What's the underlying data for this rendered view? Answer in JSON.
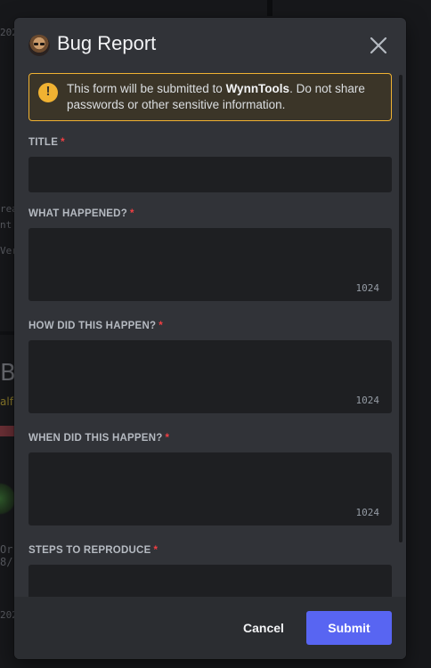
{
  "background": {
    "fragments": [
      "202",
      "rea",
      "nt",
      "Ver",
      "B",
      "alf",
      "Or",
      "8/",
      "202"
    ]
  },
  "modal": {
    "title": "Bug Report",
    "close_icon": "close-icon",
    "notice": {
      "icon": "warning-icon",
      "text_before": "This form will be submitted to ",
      "text_bold": "WynnTools",
      "text_after": ". Do not share passwords or other sensitive information.",
      "accent": "#f0b232"
    },
    "fields": [
      {
        "label": "TITLE",
        "required_mark": "*",
        "value": "",
        "counter": ""
      },
      {
        "label": "WHAT HAPPENED?",
        "required_mark": "*",
        "value": "",
        "counter": "1024"
      },
      {
        "label": "HOW DID THIS HAPPEN?",
        "required_mark": "*",
        "value": "",
        "counter": "1024"
      },
      {
        "label": "WHEN DID THIS HAPPEN?",
        "required_mark": "*",
        "value": "",
        "counter": "1024"
      },
      {
        "label": "STEPS TO REPRODUCE",
        "required_mark": "*",
        "value": "",
        "counter": ""
      }
    ],
    "footer": {
      "cancel_label": "Cancel",
      "submit_label": "Submit",
      "submit_color": "#5865f2"
    }
  }
}
